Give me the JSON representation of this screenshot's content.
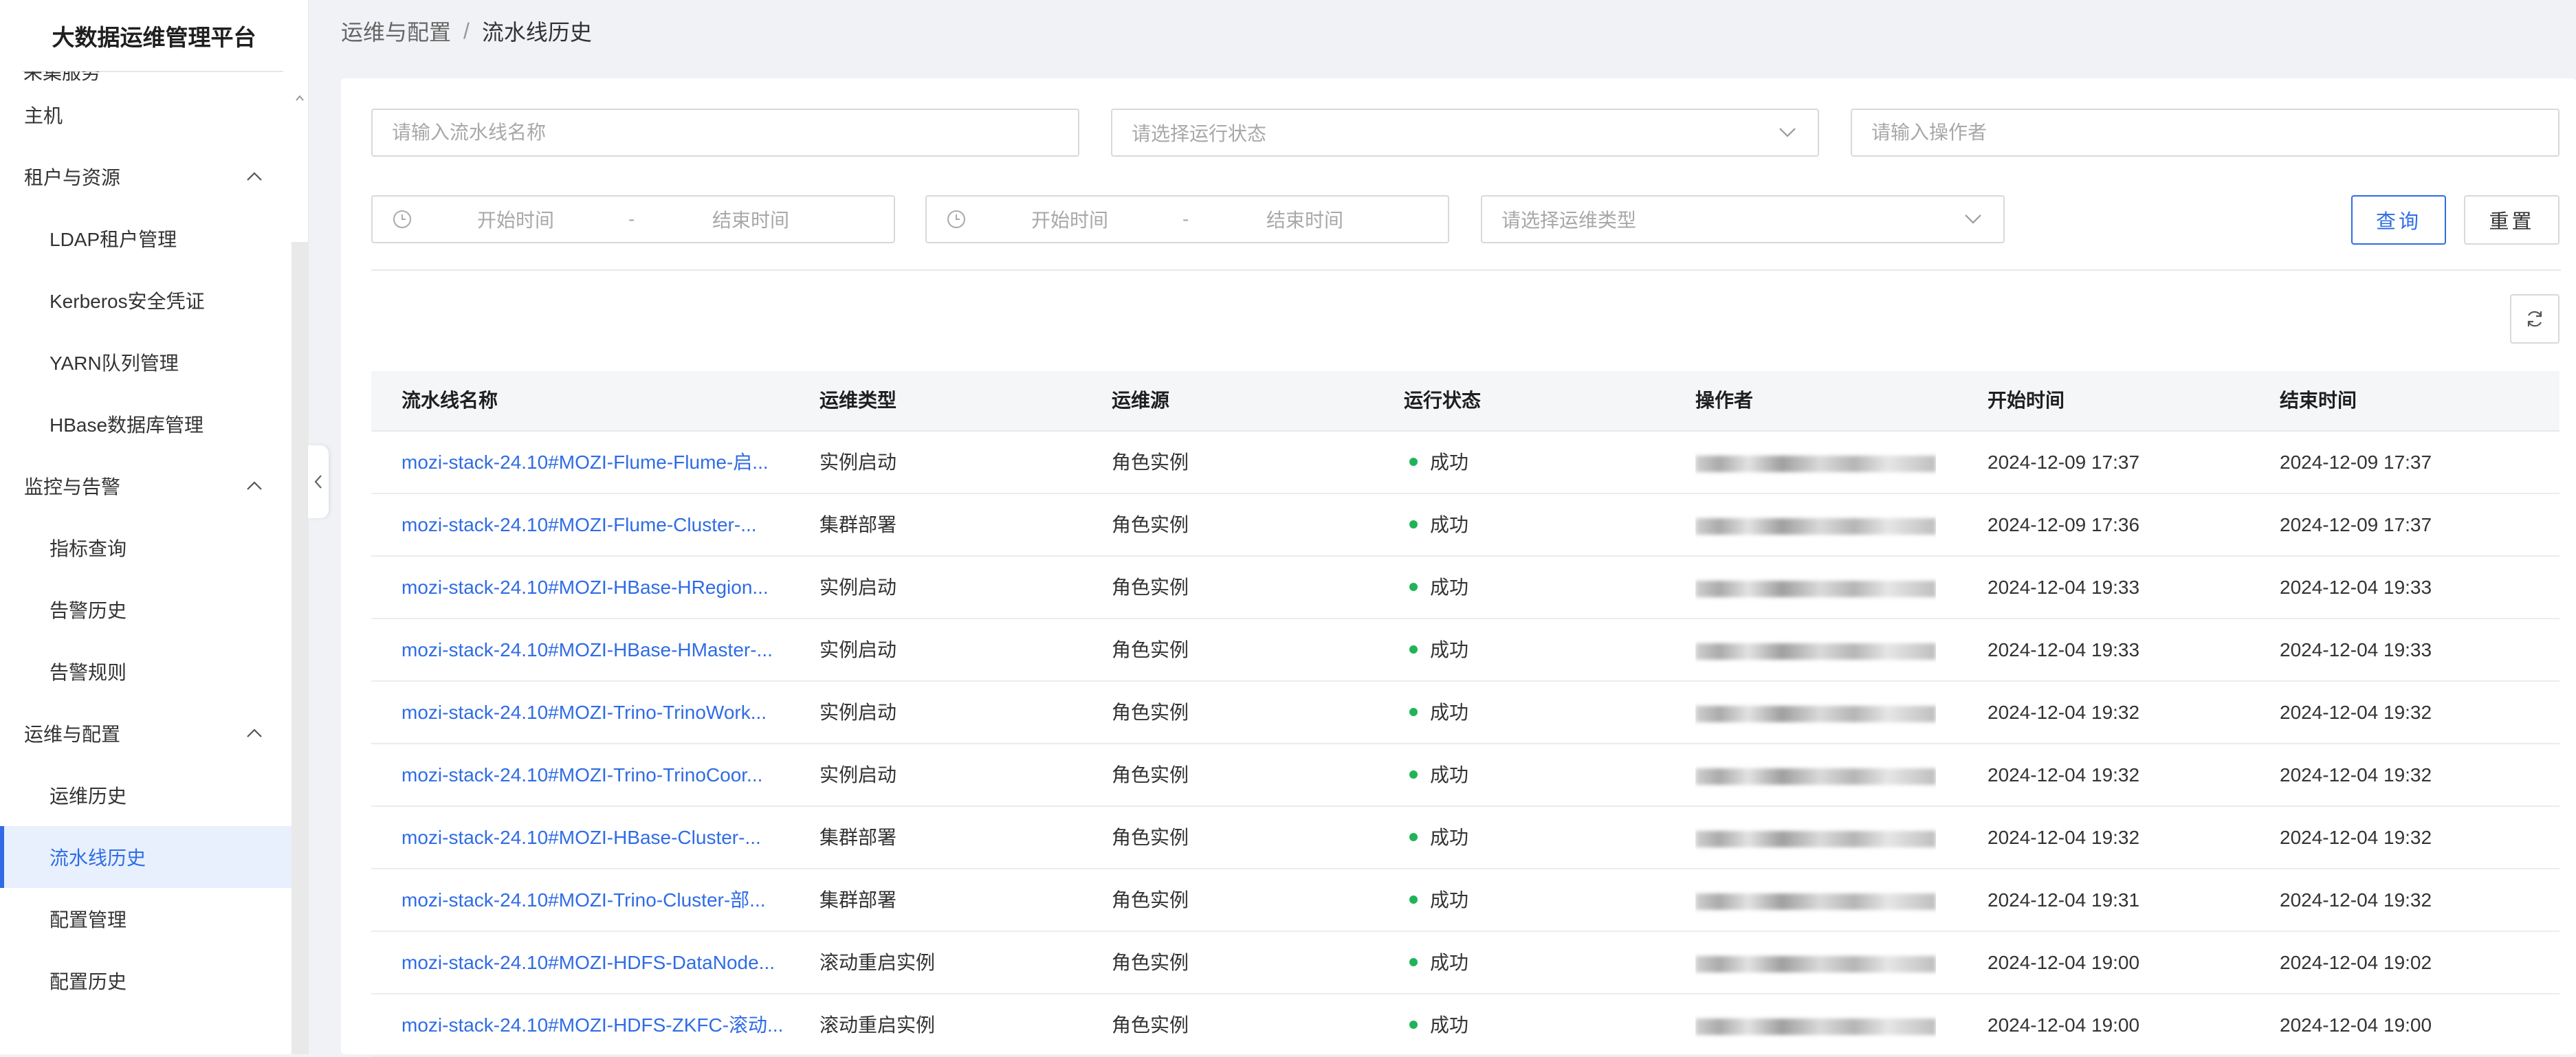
{
  "app": {
    "title": "大数据运维管理平台"
  },
  "sidebar": {
    "cut_item_label": "采集服务",
    "items": [
      {
        "label": "主机",
        "level": "top"
      },
      {
        "label": "租户与资源",
        "level": "group",
        "expanded": true
      },
      {
        "label": "LDAP租户管理",
        "level": "sub"
      },
      {
        "label": "Kerberos安全凭证",
        "level": "sub"
      },
      {
        "label": "YARN队列管理",
        "level": "sub"
      },
      {
        "label": "HBase数据库管理",
        "level": "sub"
      },
      {
        "label": "监控与告警",
        "level": "group",
        "expanded": true
      },
      {
        "label": "指标查询",
        "level": "sub"
      },
      {
        "label": "告警历史",
        "level": "sub"
      },
      {
        "label": "告警规则",
        "level": "sub"
      },
      {
        "label": "运维与配置",
        "level": "group",
        "expanded": true
      },
      {
        "label": "运维历史",
        "level": "sub"
      },
      {
        "label": "流水线历史",
        "level": "sub",
        "active": true
      },
      {
        "label": "配置管理",
        "level": "sub"
      },
      {
        "label": "配置历史",
        "level": "sub"
      }
    ]
  },
  "breadcrumb": {
    "parent": "运维与配置",
    "separator": "/",
    "current": "流水线历史"
  },
  "filters": {
    "pipeline_name_placeholder": "请输入流水线名称",
    "run_status_placeholder": "请选择运行状态",
    "operator_placeholder": "请输入操作者",
    "range1": {
      "start": "开始时间",
      "sep": "-",
      "end": "结束时间"
    },
    "range2": {
      "start": "开始时间",
      "sep": "-",
      "end": "结束时间"
    },
    "ops_type_placeholder": "请选择运维类型",
    "query_label": "查询",
    "reset_label": "重置"
  },
  "table": {
    "columns": [
      "流水线名称",
      "运维类型",
      "运维源",
      "运行状态",
      "操作者",
      "开始时间",
      "结束时间"
    ],
    "rows": [
      {
        "name": "mozi-stack-24.10#MOZI-Flume-Flume-启...",
        "type": "实例启动",
        "source": "角色实例",
        "status": "成功",
        "start": "2024-12-09 17:37",
        "end": "2024-12-09 17:37"
      },
      {
        "name": "mozi-stack-24.10#MOZI-Flume-Cluster-...",
        "type": "集群部署",
        "source": "角色实例",
        "status": "成功",
        "start": "2024-12-09 17:36",
        "end": "2024-12-09 17:37"
      },
      {
        "name": "mozi-stack-24.10#MOZI-HBase-HRegion...",
        "type": "实例启动",
        "source": "角色实例",
        "status": "成功",
        "start": "2024-12-04 19:33",
        "end": "2024-12-04 19:33"
      },
      {
        "name": "mozi-stack-24.10#MOZI-HBase-HMaster-...",
        "type": "实例启动",
        "source": "角色实例",
        "status": "成功",
        "start": "2024-12-04 19:33",
        "end": "2024-12-04 19:33"
      },
      {
        "name": "mozi-stack-24.10#MOZI-Trino-TrinoWork...",
        "type": "实例启动",
        "source": "角色实例",
        "status": "成功",
        "start": "2024-12-04 19:32",
        "end": "2024-12-04 19:32"
      },
      {
        "name": "mozi-stack-24.10#MOZI-Trino-TrinoCoor...",
        "type": "实例启动",
        "source": "角色实例",
        "status": "成功",
        "start": "2024-12-04 19:32",
        "end": "2024-12-04 19:32"
      },
      {
        "name": "mozi-stack-24.10#MOZI-HBase-Cluster-...",
        "type": "集群部署",
        "source": "角色实例",
        "status": "成功",
        "start": "2024-12-04 19:32",
        "end": "2024-12-04 19:32"
      },
      {
        "name": "mozi-stack-24.10#MOZI-Trino-Cluster-部...",
        "type": "集群部署",
        "source": "角色实例",
        "status": "成功",
        "start": "2024-12-04 19:31",
        "end": "2024-12-04 19:32"
      },
      {
        "name": "mozi-stack-24.10#MOZI-HDFS-DataNode...",
        "type": "滚动重启实例",
        "source": "角色实例",
        "status": "成功",
        "start": "2024-12-04 19:00",
        "end": "2024-12-04 19:02"
      },
      {
        "name": "mozi-stack-24.10#MOZI-HDFS-ZKFC-滚动...",
        "type": "滚动重启实例",
        "source": "角色实例",
        "status": "成功",
        "start": "2024-12-04 19:00",
        "end": "2024-12-04 19:00"
      }
    ]
  },
  "colors": {
    "accent": "#2f6ce5",
    "success": "#21b35a"
  },
  "icons": {
    "refresh": "refresh-icon",
    "collapse": "chevron-left-icon",
    "group_expand": "chevron-up-icon",
    "time": "clock-icon",
    "select": "chevron-down-icon"
  }
}
